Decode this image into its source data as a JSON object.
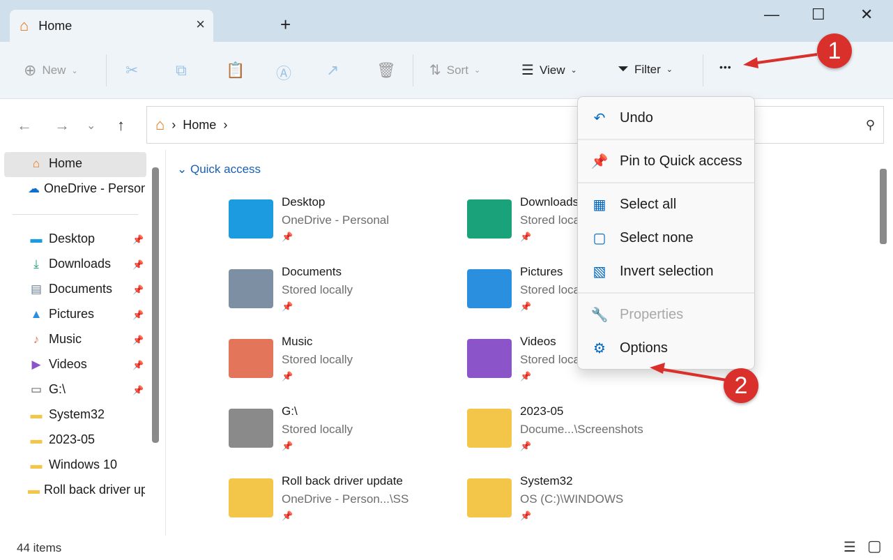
{
  "window": {
    "tab_title": "Home",
    "tab_icon": "home-icon",
    "close_tab": "×",
    "new_tab": "+",
    "minimize": "—",
    "maximize": "☐",
    "close": "✕"
  },
  "toolbar": {
    "new_label": "New",
    "sort_label": "Sort",
    "view_label": "View",
    "filter_label": "Filter",
    "more_label": "•••"
  },
  "address": {
    "crumbs": [
      "Home"
    ],
    "sep": "›"
  },
  "sidebar": {
    "home": "Home",
    "onedrive": "OneDrive - Personal",
    "items": [
      {
        "label": "Desktop",
        "icon": "desktop-icon",
        "pinned": true
      },
      {
        "label": "Downloads",
        "icon": "download-icon",
        "pinned": true
      },
      {
        "label": "Documents",
        "icon": "documents-icon",
        "pinned": true
      },
      {
        "label": "Pictures",
        "icon": "pictures-icon",
        "pinned": true
      },
      {
        "label": "Music",
        "icon": "music-icon",
        "pinned": true
      },
      {
        "label": "Videos",
        "icon": "videos-icon",
        "pinned": true
      },
      {
        "label": "G:\\",
        "icon": "drive-icon",
        "pinned": true
      },
      {
        "label": "System32",
        "icon": "folder-icon",
        "pinned": false
      },
      {
        "label": "2023-05",
        "icon": "folder-icon",
        "pinned": false
      },
      {
        "label": "Windows 10",
        "icon": "folder-icon",
        "pinned": false
      },
      {
        "label": "Roll back driver update",
        "icon": "folder-icon",
        "pinned": false
      }
    ]
  },
  "main": {
    "section": "Quick access",
    "tiles": [
      {
        "name": "Desktop",
        "sub": "OneDrive - Personal",
        "color": "#1d9be0"
      },
      {
        "name": "Downloads",
        "sub": "Stored locally",
        "color": "#1aa37a"
      },
      {
        "name": "Documents",
        "sub": "Stored locally",
        "color": "#7d8fa3"
      },
      {
        "name": "Pictures",
        "sub": "Stored locally",
        "color": "#2b8fe0"
      },
      {
        "name": "Music",
        "sub": "Stored locally",
        "color": "#e3765a"
      },
      {
        "name": "Videos",
        "sub": "Stored locally",
        "color": "#8b54c9"
      },
      {
        "name": "G:\\",
        "sub": "Stored locally",
        "color": "#8a8a8a"
      },
      {
        "name": "2023-05",
        "sub": "Docume...\\Screenshots",
        "color": "#f3c64a"
      },
      {
        "name": "Roll back driver update",
        "sub": "OneDrive - Person...\\SS",
        "color": "#f3c64a"
      },
      {
        "name": "System32",
        "sub": "OS (C:)\\WINDOWS",
        "color": "#f3c64a"
      }
    ]
  },
  "menu": {
    "items": [
      {
        "label": "Undo",
        "icon": "undo-icon",
        "glyph": "↶",
        "disabled": false
      },
      {
        "label": "Pin to Quick access",
        "icon": "pin-icon",
        "glyph": "📌",
        "disabled": false
      },
      {
        "label": "Select all",
        "icon": "select-all-icon",
        "glyph": "▦",
        "disabled": false
      },
      {
        "label": "Select none",
        "icon": "select-none-icon",
        "glyph": "▢",
        "disabled": false
      },
      {
        "label": "Invert selection",
        "icon": "invert-selection-icon",
        "glyph": "▧",
        "disabled": false
      },
      {
        "label": "Properties",
        "icon": "wrench-icon",
        "glyph": "🔧",
        "disabled": true
      },
      {
        "label": "Options",
        "icon": "gear-icon",
        "glyph": "⚙",
        "disabled": false
      }
    ]
  },
  "annotations": [
    "1",
    "2"
  ],
  "status": {
    "count": "44 items"
  },
  "colors": {
    "accent": "#0067c0",
    "annotation": "#d9302c"
  }
}
